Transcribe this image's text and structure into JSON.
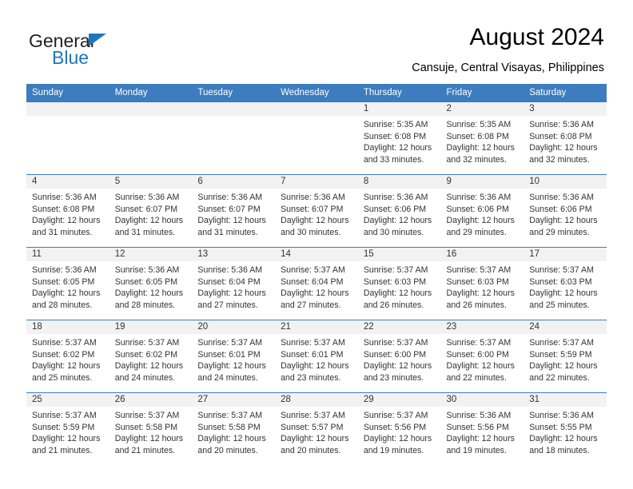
{
  "logo": {
    "word_one": "General",
    "word_two": "Blue",
    "triangle_color": "#1f76bc",
    "text_color": "#231f20"
  },
  "header": {
    "title": "August 2024",
    "subtitle": "Cansuje, Central Visayas, Philippines"
  },
  "theme": {
    "header_blue": "#3c7cbf",
    "daynum_band": "#f2f2f2",
    "text": "#333333"
  },
  "weekday_headers": [
    "Sunday",
    "Monday",
    "Tuesday",
    "Wednesday",
    "Thursday",
    "Friday",
    "Saturday"
  ],
  "weeks": [
    [
      {
        "day": "",
        "sunrise": "",
        "sunset": "",
        "daylight": "",
        "empty": true
      },
      {
        "day": "",
        "sunrise": "",
        "sunset": "",
        "daylight": "",
        "empty": true
      },
      {
        "day": "",
        "sunrise": "",
        "sunset": "",
        "daylight": "",
        "empty": true
      },
      {
        "day": "",
        "sunrise": "",
        "sunset": "",
        "daylight": "",
        "empty": true
      },
      {
        "day": "1",
        "sunrise": "Sunrise: 5:35 AM",
        "sunset": "Sunset: 6:08 PM",
        "daylight": "Daylight: 12 hours and 33 minutes.",
        "empty": false
      },
      {
        "day": "2",
        "sunrise": "Sunrise: 5:35 AM",
        "sunset": "Sunset: 6:08 PM",
        "daylight": "Daylight: 12 hours and 32 minutes.",
        "empty": false
      },
      {
        "day": "3",
        "sunrise": "Sunrise: 5:36 AM",
        "sunset": "Sunset: 6:08 PM",
        "daylight": "Daylight: 12 hours and 32 minutes.",
        "empty": false
      }
    ],
    [
      {
        "day": "4",
        "sunrise": "Sunrise: 5:36 AM",
        "sunset": "Sunset: 6:08 PM",
        "daylight": "Daylight: 12 hours and 31 minutes.",
        "empty": false
      },
      {
        "day": "5",
        "sunrise": "Sunrise: 5:36 AM",
        "sunset": "Sunset: 6:07 PM",
        "daylight": "Daylight: 12 hours and 31 minutes.",
        "empty": false
      },
      {
        "day": "6",
        "sunrise": "Sunrise: 5:36 AM",
        "sunset": "Sunset: 6:07 PM",
        "daylight": "Daylight: 12 hours and 31 minutes.",
        "empty": false
      },
      {
        "day": "7",
        "sunrise": "Sunrise: 5:36 AM",
        "sunset": "Sunset: 6:07 PM",
        "daylight": "Daylight: 12 hours and 30 minutes.",
        "empty": false
      },
      {
        "day": "8",
        "sunrise": "Sunrise: 5:36 AM",
        "sunset": "Sunset: 6:06 PM",
        "daylight": "Daylight: 12 hours and 30 minutes.",
        "empty": false
      },
      {
        "day": "9",
        "sunrise": "Sunrise: 5:36 AM",
        "sunset": "Sunset: 6:06 PM",
        "daylight": "Daylight: 12 hours and 29 minutes.",
        "empty": false
      },
      {
        "day": "10",
        "sunrise": "Sunrise: 5:36 AM",
        "sunset": "Sunset: 6:06 PM",
        "daylight": "Daylight: 12 hours and 29 minutes.",
        "empty": false
      }
    ],
    [
      {
        "day": "11",
        "sunrise": "Sunrise: 5:36 AM",
        "sunset": "Sunset: 6:05 PM",
        "daylight": "Daylight: 12 hours and 28 minutes.",
        "empty": false
      },
      {
        "day": "12",
        "sunrise": "Sunrise: 5:36 AM",
        "sunset": "Sunset: 6:05 PM",
        "daylight": "Daylight: 12 hours and 28 minutes.",
        "empty": false
      },
      {
        "day": "13",
        "sunrise": "Sunrise: 5:36 AM",
        "sunset": "Sunset: 6:04 PM",
        "daylight": "Daylight: 12 hours and 27 minutes.",
        "empty": false
      },
      {
        "day": "14",
        "sunrise": "Sunrise: 5:37 AM",
        "sunset": "Sunset: 6:04 PM",
        "daylight": "Daylight: 12 hours and 27 minutes.",
        "empty": false
      },
      {
        "day": "15",
        "sunrise": "Sunrise: 5:37 AM",
        "sunset": "Sunset: 6:03 PM",
        "daylight": "Daylight: 12 hours and 26 minutes.",
        "empty": false
      },
      {
        "day": "16",
        "sunrise": "Sunrise: 5:37 AM",
        "sunset": "Sunset: 6:03 PM",
        "daylight": "Daylight: 12 hours and 26 minutes.",
        "empty": false
      },
      {
        "day": "17",
        "sunrise": "Sunrise: 5:37 AM",
        "sunset": "Sunset: 6:03 PM",
        "daylight": "Daylight: 12 hours and 25 minutes.",
        "empty": false
      }
    ],
    [
      {
        "day": "18",
        "sunrise": "Sunrise: 5:37 AM",
        "sunset": "Sunset: 6:02 PM",
        "daylight": "Daylight: 12 hours and 25 minutes.",
        "empty": false
      },
      {
        "day": "19",
        "sunrise": "Sunrise: 5:37 AM",
        "sunset": "Sunset: 6:02 PM",
        "daylight": "Daylight: 12 hours and 24 minutes.",
        "empty": false
      },
      {
        "day": "20",
        "sunrise": "Sunrise: 5:37 AM",
        "sunset": "Sunset: 6:01 PM",
        "daylight": "Daylight: 12 hours and 24 minutes.",
        "empty": false
      },
      {
        "day": "21",
        "sunrise": "Sunrise: 5:37 AM",
        "sunset": "Sunset: 6:01 PM",
        "daylight": "Daylight: 12 hours and 23 minutes.",
        "empty": false
      },
      {
        "day": "22",
        "sunrise": "Sunrise: 5:37 AM",
        "sunset": "Sunset: 6:00 PM",
        "daylight": "Daylight: 12 hours and 23 minutes.",
        "empty": false
      },
      {
        "day": "23",
        "sunrise": "Sunrise: 5:37 AM",
        "sunset": "Sunset: 6:00 PM",
        "daylight": "Daylight: 12 hours and 22 minutes.",
        "empty": false
      },
      {
        "day": "24",
        "sunrise": "Sunrise: 5:37 AM",
        "sunset": "Sunset: 5:59 PM",
        "daylight": "Daylight: 12 hours and 22 minutes.",
        "empty": false
      }
    ],
    [
      {
        "day": "25",
        "sunrise": "Sunrise: 5:37 AM",
        "sunset": "Sunset: 5:59 PM",
        "daylight": "Daylight: 12 hours and 21 minutes.",
        "empty": false
      },
      {
        "day": "26",
        "sunrise": "Sunrise: 5:37 AM",
        "sunset": "Sunset: 5:58 PM",
        "daylight": "Daylight: 12 hours and 21 minutes.",
        "empty": false
      },
      {
        "day": "27",
        "sunrise": "Sunrise: 5:37 AM",
        "sunset": "Sunset: 5:58 PM",
        "daylight": "Daylight: 12 hours and 20 minutes.",
        "empty": false
      },
      {
        "day": "28",
        "sunrise": "Sunrise: 5:37 AM",
        "sunset": "Sunset: 5:57 PM",
        "daylight": "Daylight: 12 hours and 20 minutes.",
        "empty": false
      },
      {
        "day": "29",
        "sunrise": "Sunrise: 5:37 AM",
        "sunset": "Sunset: 5:56 PM",
        "daylight": "Daylight: 12 hours and 19 minutes.",
        "empty": false
      },
      {
        "day": "30",
        "sunrise": "Sunrise: 5:36 AM",
        "sunset": "Sunset: 5:56 PM",
        "daylight": "Daylight: 12 hours and 19 minutes.",
        "empty": false
      },
      {
        "day": "31",
        "sunrise": "Sunrise: 5:36 AM",
        "sunset": "Sunset: 5:55 PM",
        "daylight": "Daylight: 12 hours and 18 minutes.",
        "empty": false
      }
    ]
  ]
}
